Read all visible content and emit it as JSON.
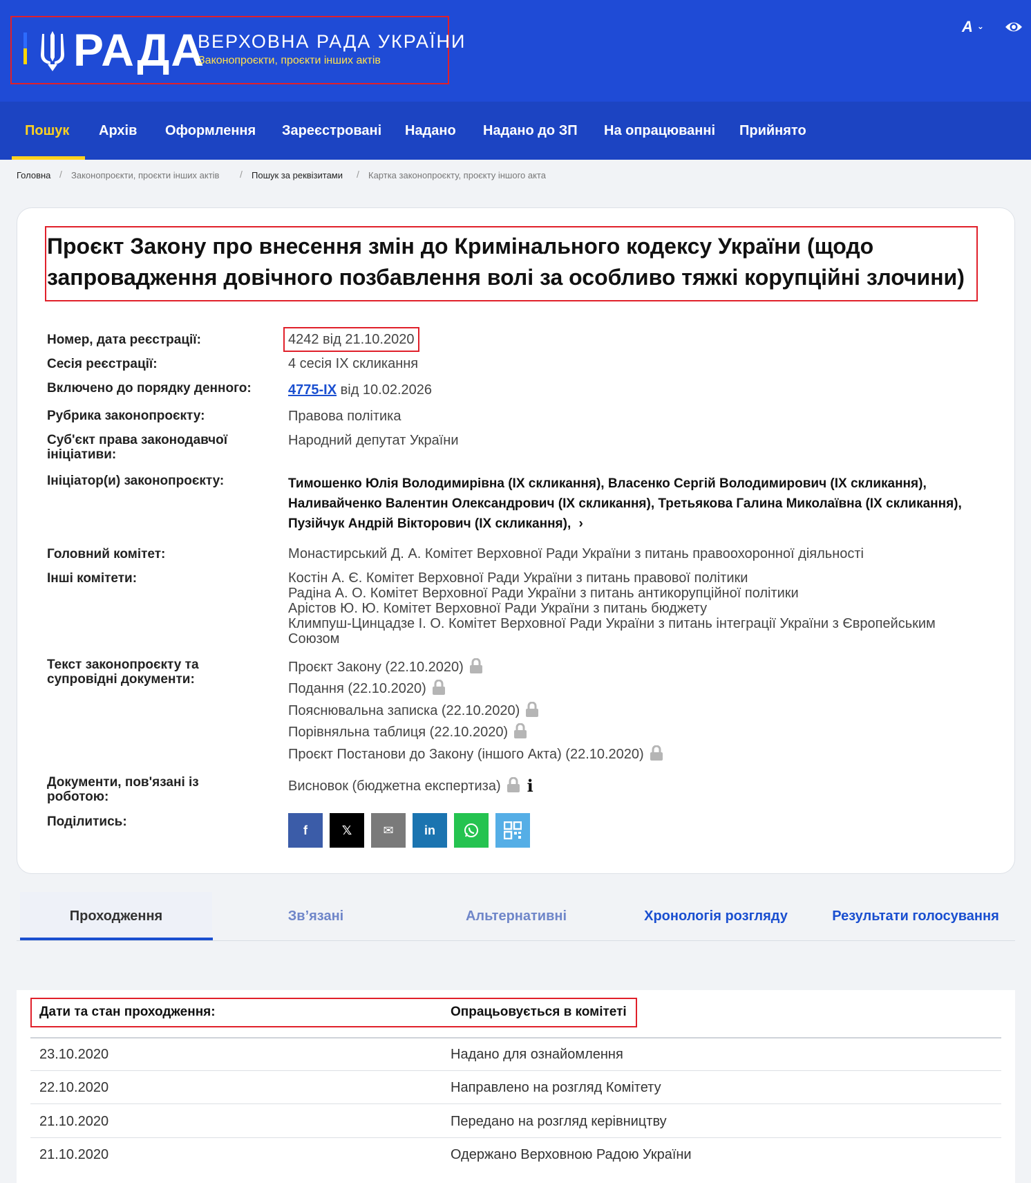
{
  "header": {
    "logo_word": "РАДА",
    "org_name": "ВЕРХОВНА РАДА УКРАЇНИ",
    "section_name": "Законопроєкти, проєкти інших актів",
    "font_button": "A"
  },
  "nav": {
    "items": [
      "Пошук",
      "Архів",
      "Оформлення",
      "Зареєстровані",
      "Надано",
      "Надано до ЗП",
      "На опрацюванні",
      "Прийнято"
    ]
  },
  "breadcrumb": [
    "Головна",
    "Законопроєкти, проєкти інших актів",
    "Пошук за реквізитами",
    "Картка законопроєкту, проєкту іншого акта"
  ],
  "bill": {
    "title": "Проєкт Закону про внесення змін до Кримінального кодексу України (щодо запровадження довічного позбавлення волі за особливо тяжкі корупційні злочини)",
    "labels": {
      "reg": "Номер, дата реєстрації:",
      "session": "Сесія реєстрації:",
      "agenda": "Включено до порядку денного:",
      "rubric": "Рубрика законопроєкту:",
      "subject": "Суб'єкт права законодавчої ініціативи:",
      "initiators": "Ініціатор(и) законопроєкту:",
      "main_committee": "Головний комітет:",
      "other_committees": "Інші комітети:",
      "texts": "Текст законопроєкту та супровідні документи:",
      "related_docs": "Документи, пов'язані із роботою:",
      "share": "Поділитись:"
    },
    "reg": "4242 від 21.10.2020",
    "session": "4 сесія IX скликання",
    "agenda_link": "4775-IX",
    "agenda_date": "від 10.02.2026",
    "rubric": "Правова політика",
    "subject": "Народний депутат України",
    "initiators": "Тимошенко Юлія Володимирівна (IX скликання), Власенко Сергій Володимирович (IX скликання), Наливайченко Валентин Олександрович (IX скликання), Третьякова Галина Миколаївна (IX скликання), Пузійчук Андрій Вікторович (IX скликання),",
    "initiators_more": "›",
    "main_committee": "Монастирський Д. А. Комітет Верховної Ради України з питань правоохоронної діяльності",
    "other_committees": [
      "Костін А. Є. Комітет Верховної Ради України з питань правової політики",
      "Радіна А. О. Комітет Верховної Ради України з питань антикорупційної політики",
      "Арістов Ю. Ю. Комітет Верховної Ради України з питань бюджету",
      "Климпуш-Цинцадзе І. О. Комітет Верховної Ради України з питань інтеграції України з Європейським",
      "Союзом"
    ],
    "texts": [
      "Проєкт Закону (22.10.2020)",
      "Подання (22.10.2020)",
      "Пояснювальна записка (22.10.2020)",
      "Порівняльна таблиця (22.10.2020)",
      "Проєкт Постанови до Закону (іншого Акта) (22.10.2020)"
    ],
    "related_docs": [
      "Висновок (бюджетна експертиза)"
    ],
    "share_buttons": [
      "f",
      "𝕏",
      "✉",
      "in",
      "whatsapp",
      "qr"
    ]
  },
  "tabs": [
    "Проходження",
    "Зв’язані",
    "Альтернативні",
    "Хронологія розгляду",
    "Результати голосування"
  ],
  "status": {
    "header_label": "Дати та стан проходження:",
    "header_value": "Опрацьовується в комітеті",
    "rows": [
      {
        "date": "23.10.2020",
        "event": "Надано для ознайомлення"
      },
      {
        "date": "22.10.2020",
        "event": "Направлено на розгляд Комітету"
      },
      {
        "date": "21.10.2020",
        "event": "Передано на розгляд керівництву"
      },
      {
        "date": "21.10.2020",
        "event": "Одержано Верховною Радою України"
      }
    ]
  },
  "colors": {
    "brand_blue": "#1f4bd6",
    "nav_blue": "#1c44c2",
    "accent_yellow": "#ffd21f",
    "link_blue": "#1a4fd0",
    "highlight_red": "#e0202a"
  }
}
